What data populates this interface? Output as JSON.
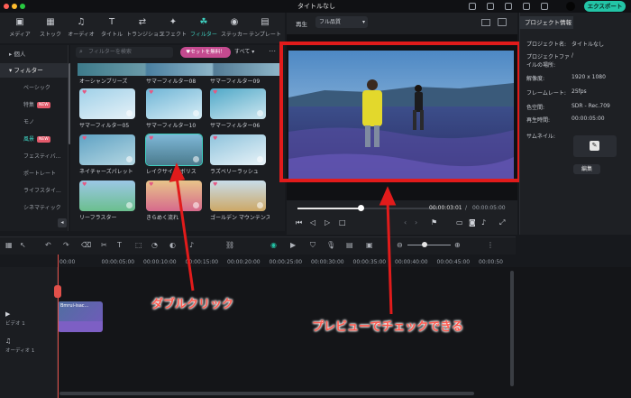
{
  "window": {
    "title": "タイトルなし",
    "export_label": "エクスポート"
  },
  "toolbar": {
    "tools": [
      {
        "icon": "media-icon",
        "glyph": "▣",
        "label": "メディア"
      },
      {
        "icon": "stock-icon",
        "glyph": "▦",
        "label": "ストック"
      },
      {
        "icon": "audio-icon",
        "glyph": "♫",
        "label": "オーディオ"
      },
      {
        "icon": "title-icon",
        "glyph": "T",
        "label": "タイトル"
      },
      {
        "icon": "transition-icon",
        "glyph": "⇄",
        "label": "トランジション"
      },
      {
        "icon": "effect-icon",
        "glyph": "✦",
        "label": "エフェクト"
      },
      {
        "icon": "filter-icon",
        "glyph": "☘",
        "label": "フィルター",
        "active": true
      },
      {
        "icon": "sticker-icon",
        "glyph": "◉",
        "label": "ステッカー"
      },
      {
        "icon": "template-icon",
        "glyph": "▤",
        "label": "テンプレート"
      }
    ]
  },
  "sidebar": {
    "personal": "個人",
    "filter": "フィルター",
    "items": [
      {
        "label": "ベーシック"
      },
      {
        "label": "特集",
        "new": "NEW"
      },
      {
        "label": "モノ"
      },
      {
        "label": "風景",
        "new": "NEW",
        "hl": true
      },
      {
        "label": "フェスティバ..."
      },
      {
        "label": "ポートレート"
      },
      {
        "label": "ライフスタイ..."
      },
      {
        "label": "シネマティック"
      }
    ]
  },
  "browser": {
    "search_placeholder": "フィルターを検索",
    "pill": "♥セットを無料！",
    "select_label": "すべて",
    "row0_labels": [
      "オーシャンブリーズ",
      "サマーフィルター08",
      "サマーフィルター09"
    ],
    "items": [
      {
        "label": "サマーフィルター05"
      },
      {
        "label": "サマーフィルター10"
      },
      {
        "label": "サマーフィルター06"
      },
      {
        "label": "ネイチャーズパレット"
      },
      {
        "label": "レイクサイド ボリス"
      },
      {
        "label": "ラズベリーラッシュ"
      },
      {
        "label": "リーフラスター"
      },
      {
        "label": "きらめく流れ"
      },
      {
        "label": "ゴールデン マウンテンズ"
      }
    ]
  },
  "preview": {
    "label": "再生",
    "quality": "フル品質",
    "time_current": "00:00:03:01",
    "time_total": "00:00:05:00",
    "progress": 0.45
  },
  "properties": {
    "tab": "プロジェクト情報",
    "rows": [
      {
        "k": "プロジェクト名:",
        "v": "タイトルなし"
      },
      {
        "k": "プロジェクトファイルの場所:",
        "v": "/"
      },
      {
        "k": "解像度:",
        "v": "1920 x 1080"
      },
      {
        "k": "フレームレート:",
        "v": "25fps"
      },
      {
        "k": "色空間:",
        "v": "SDR - Rec.709"
      },
      {
        "k": "再生時間:",
        "v": "00:00:05:00"
      },
      {
        "k": "サムネイル:",
        "v": ""
      }
    ],
    "edit_label": "編集"
  },
  "timeline": {
    "ticks": [
      "00:00",
      "00:00:05:00",
      "00:00:10:00",
      "00:00:15:00",
      "00:00:20:00",
      "00:00:25:00",
      "00:00:30:00",
      "00:00:35:00",
      "00:00:40:00",
      "00:00:45:00",
      "00:00:50"
    ],
    "video_track": "ビデオ 1",
    "audio_track": "オーディオ 1",
    "clip_label": "Bmrui-isac..."
  },
  "annotations": {
    "double_click": "ダブルクリック",
    "preview_check": "プレビューでチェックできる"
  },
  "colors": {
    "accent": "#23c4a6",
    "annotation": "#e11b1b"
  }
}
